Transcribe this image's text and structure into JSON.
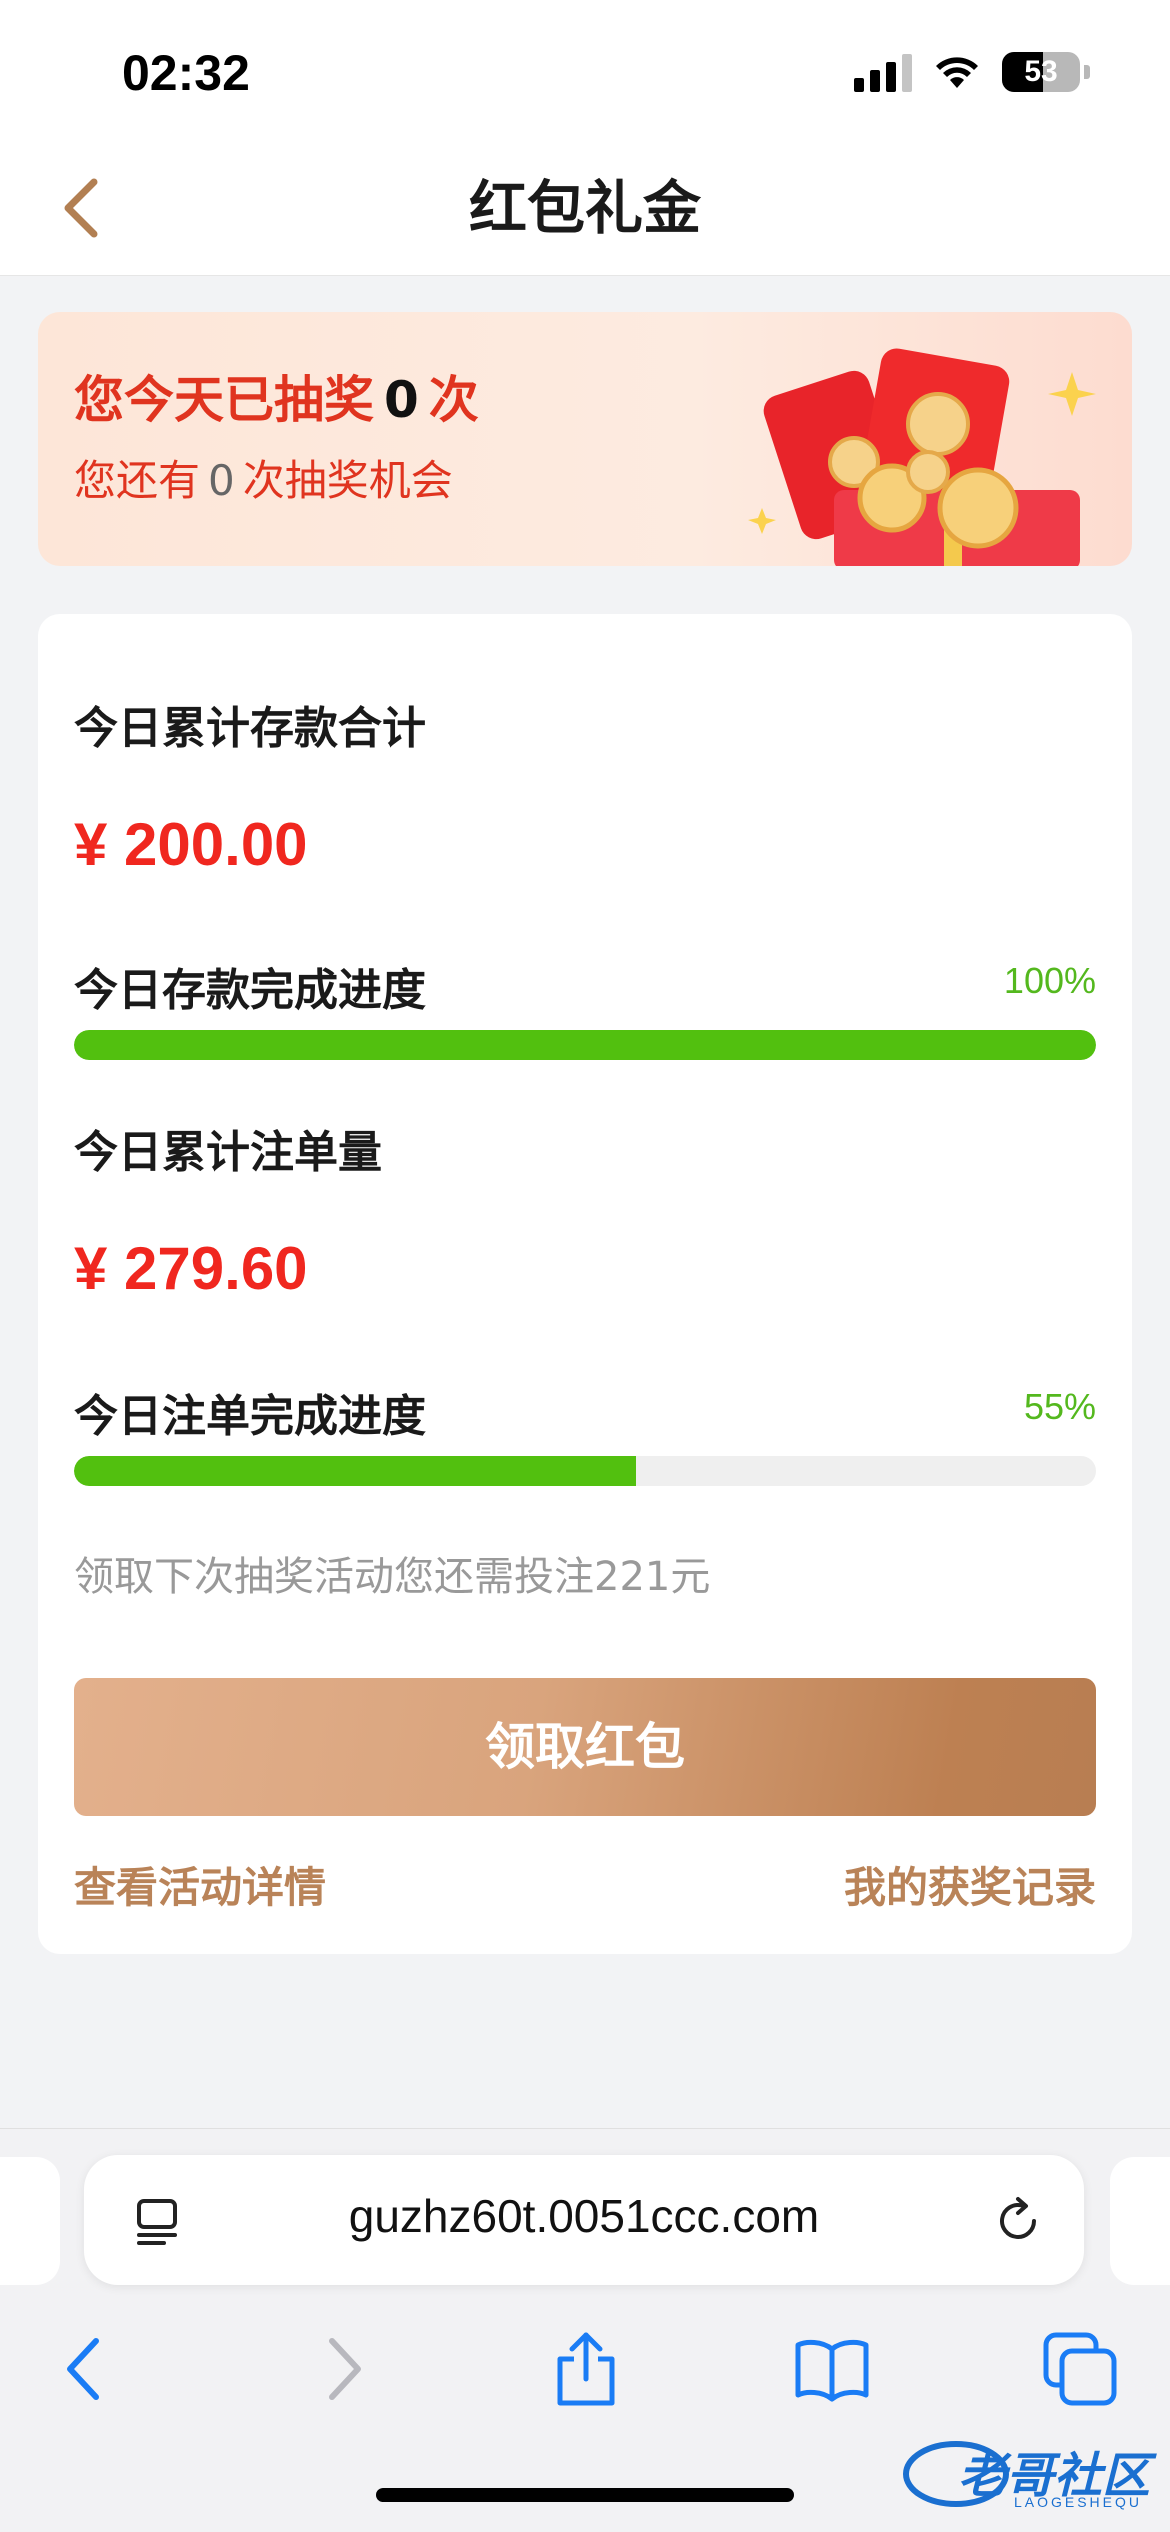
{
  "status_bar": {
    "time": "02:32",
    "battery": "53",
    "battery_level": 0.53
  },
  "header": {
    "title": "红包礼金",
    "back_icon": "chevron-left-icon"
  },
  "banner": {
    "line1_prefix": "您今天已抽奖",
    "line1_count": "0",
    "line1_suffix": "次",
    "line2_prefix": "您还有",
    "line2_count": "0",
    "line2_suffix": "次抽奖机会",
    "art_icon": "red-envelope-gift-icon"
  },
  "deposit": {
    "label": "今日累计存款合计",
    "amount": "¥ 200.00",
    "progress_label": "今日存款完成进度",
    "progress_text": "100%",
    "progress_value": 1.0
  },
  "bet": {
    "label": "今日累计注单量",
    "amount": "¥ 279.60",
    "progress_label": "今日注单完成进度",
    "progress_text": "55%",
    "progress_value": 0.55
  },
  "hint": "领取下次抽奖活动您还需投注221元",
  "claim_button": "领取红包",
  "links": {
    "details": "查看活动详情",
    "records": "我的获奖记录"
  },
  "browser": {
    "url": "guzhz60t.0051ccc.com",
    "toolbar_icons": [
      "back-icon",
      "forward-icon",
      "share-icon",
      "bookmarks-icon",
      "tabs-icon"
    ]
  },
  "watermark": {
    "text": "老哥社区",
    "sub": "LAOGESHEQU"
  },
  "colors": {
    "accent_red": "#f0271f",
    "progress_green": "#52c00f",
    "gold": "#b98358"
  }
}
